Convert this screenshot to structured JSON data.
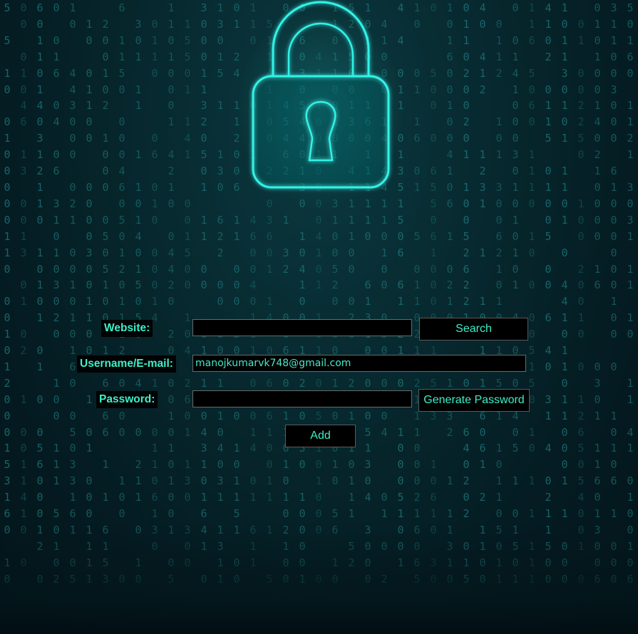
{
  "hero": {
    "icon": "padlock-icon",
    "accent_color": "#33f2e6"
  },
  "form": {
    "website": {
      "label": "Website:",
      "value": ""
    },
    "username": {
      "label": "Username/E-mail:",
      "value": "manojkumarvk748@gmail.com"
    },
    "password": {
      "label": "Password:",
      "value": ""
    },
    "search_button": "Search",
    "generate_button": "Generate Password",
    "add_button": "Add"
  },
  "colors": {
    "label_text": "#3cf0c8",
    "background": "#072a30"
  }
}
